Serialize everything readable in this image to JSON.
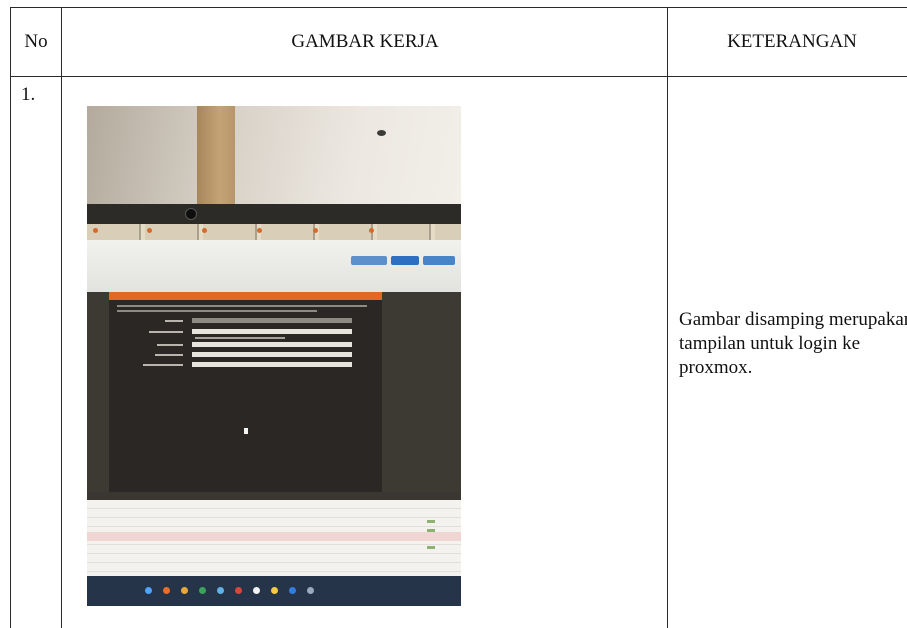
{
  "table": {
    "headers": {
      "no": "No",
      "gambar": "GAMBAR KERJA",
      "keterangan": "KETERANGAN"
    },
    "rows": [
      {
        "no": "1.",
        "image_description": "photo of monitor showing proxmox login screen",
        "keterangan": "Gambar disamping merupakan tampilan untuk login ke proxmox."
      }
    ]
  },
  "colors": {
    "border": "#2a2a2a",
    "terminal_bar": "#e06a25",
    "terminal_bg": "#2b2724",
    "taskbar": "#26344a"
  }
}
